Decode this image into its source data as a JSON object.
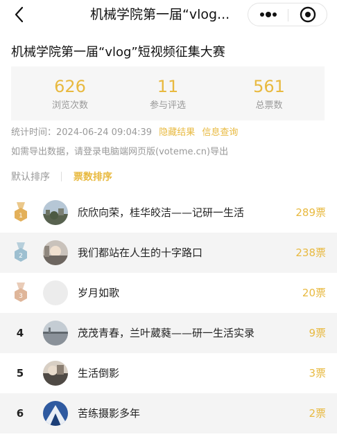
{
  "nav": {
    "title": "机械学院第一届“vlog...",
    "back_icon": "chevron-left-icon",
    "more_icon": "more-dots-icon",
    "close_icon": "target-close-icon"
  },
  "page_title": "机械学院第一届“vlog”短视频征集大赛",
  "stats": [
    {
      "value": "626",
      "label": "浏览次数"
    },
    {
      "value": "11",
      "label": "参与评选"
    },
    {
      "value": "561",
      "label": "总票数"
    }
  ],
  "meta": {
    "time_label": "统计时间：2024-06-24 09:04:39",
    "hide_results": "隐藏结果",
    "info_query": "信息查询",
    "export_hint": "如需导出数据，请登录电脑端网页版(voteme.cn)导出"
  },
  "sort": {
    "default": "默认排序",
    "by_votes": "票数排序"
  },
  "colors": {
    "accent": "#e8b93f",
    "gold_medal": "#e3b05a",
    "silver_medal": "#9dbfd0",
    "bronze_medal": "#dfb69a"
  },
  "entries": [
    {
      "rank": "1",
      "medal": "gold",
      "title": "欣欣向荣，桂华皎洁——记研一生活",
      "votes": "289票"
    },
    {
      "rank": "2",
      "medal": "silver",
      "title": "我们都站在人生的十字路口",
      "votes": "238票"
    },
    {
      "rank": "3",
      "medal": "bronze",
      "title": "岁月如歌",
      "votes": "20票"
    },
    {
      "rank": "4",
      "medal": "",
      "title": "茂茂青春，兰叶葳蕤——研一生活实录",
      "votes": "9票"
    },
    {
      "rank": "5",
      "medal": "",
      "title": "生活倒影",
      "votes": "3票"
    },
    {
      "rank": "6",
      "medal": "",
      "title": "苦练摄影多年",
      "votes": "2票"
    }
  ]
}
